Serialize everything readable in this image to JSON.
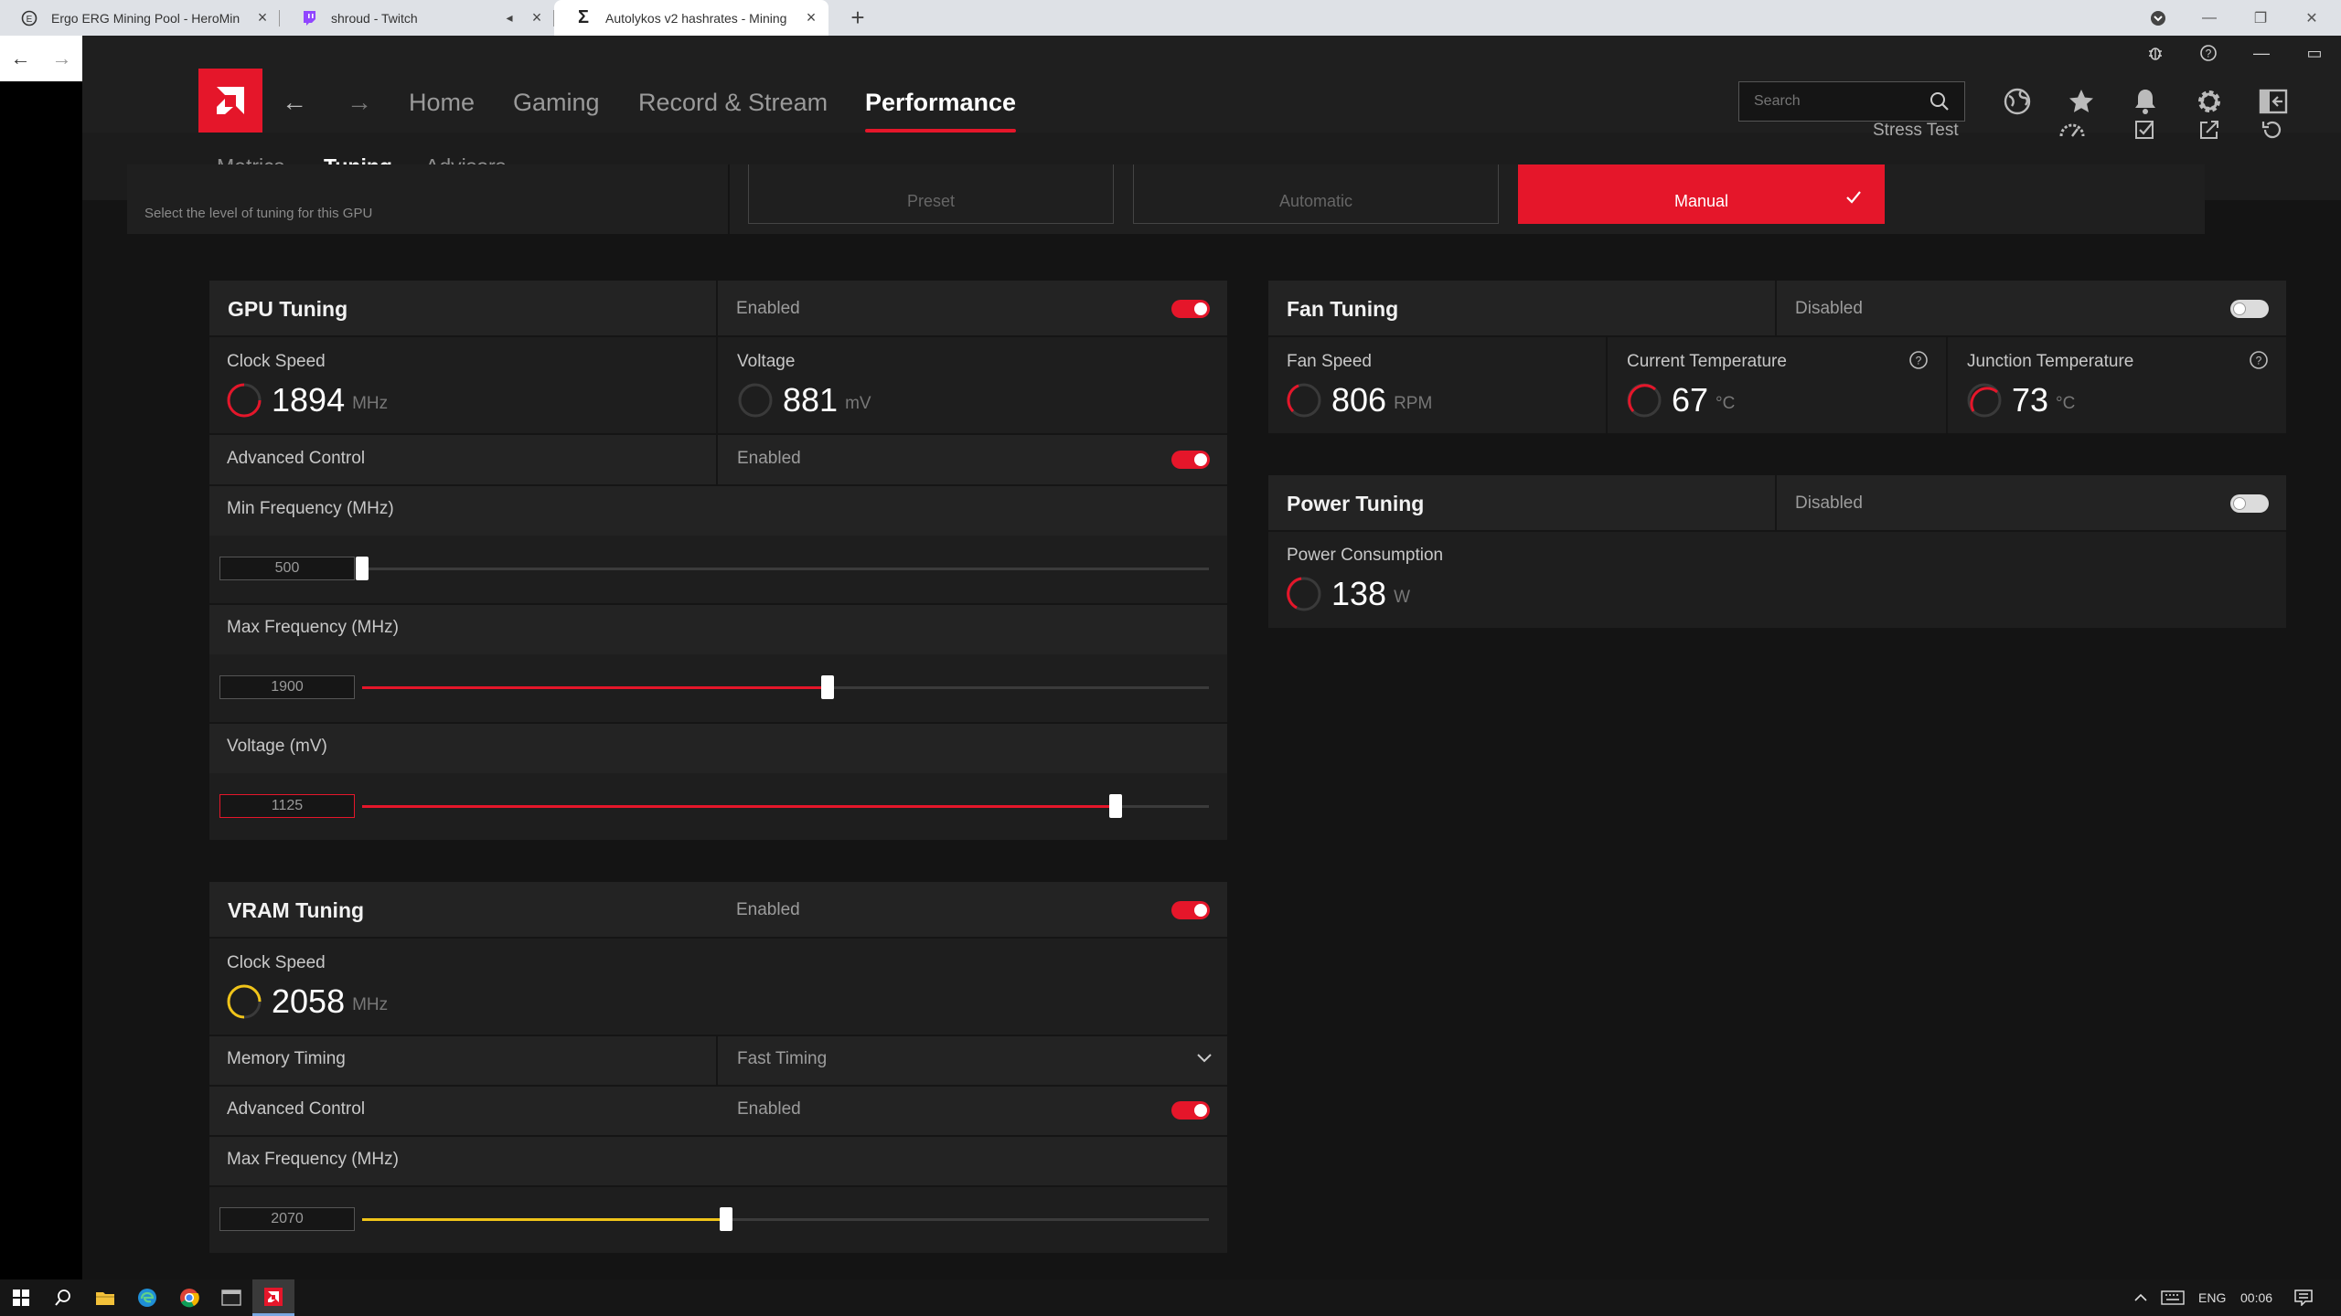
{
  "browser": {
    "tabs": [
      {
        "title": "Ergo ERG Mining Pool - HeroMin",
        "icon": "herominers-icon",
        "active": false
      },
      {
        "title": "shroud - Twitch",
        "icon": "twitch-icon",
        "active": false
      },
      {
        "title": "Autolykos v2 hashrates - Mining",
        "icon": "sigma-icon",
        "active": true
      }
    ]
  },
  "app": {
    "nav": [
      "Home",
      "Gaming",
      "Record & Stream",
      "Performance"
    ],
    "selected_nav": "Performance",
    "search_placeholder": "Search",
    "subnav": [
      "Metrics",
      "Tuning",
      "Advisors"
    ],
    "selected_subnav": "Tuning",
    "stress_test": "Stress Test"
  },
  "tuning_control": {
    "description": "Select the level of tuning for this GPU",
    "options": [
      "Preset",
      "Automatic",
      "Manual"
    ],
    "selected": "Manual"
  },
  "gpu_tuning": {
    "title": "GPU Tuning",
    "status": "Enabled",
    "clock_speed": {
      "label": "Clock Speed",
      "value": "1894",
      "unit": "MHz"
    },
    "voltage": {
      "label": "Voltage",
      "value": "881",
      "unit": "mV"
    },
    "advanced_control": {
      "label": "Advanced Control",
      "status": "Enabled"
    },
    "min_frequency": {
      "label": "Min Frequency (MHz)",
      "value": "500",
      "fraction": 0.0
    },
    "max_frequency": {
      "label": "Max Frequency (MHz)",
      "value": "1900",
      "fraction": 0.55
    },
    "voltage_slider": {
      "label": "Voltage (mV)",
      "value": "1125",
      "fraction": 0.89
    }
  },
  "vram_tuning": {
    "title": "VRAM Tuning",
    "status": "Enabled",
    "clock_speed": {
      "label": "Clock Speed",
      "value": "2058",
      "unit": "MHz"
    },
    "memory_timing": {
      "label": "Memory Timing",
      "value": "Fast Timing"
    },
    "advanced_control": {
      "label": "Advanced Control",
      "status": "Enabled"
    },
    "max_frequency": {
      "label": "Max Frequency (MHz)",
      "value": "2070",
      "fraction": 0.43
    }
  },
  "fan_tuning": {
    "title": "Fan Tuning",
    "status": "Disabled",
    "fan_speed": {
      "label": "Fan Speed",
      "value": "806",
      "unit": "RPM"
    },
    "current_temperature": {
      "label": "Current Temperature",
      "value": "67",
      "unit": "°C"
    },
    "junction_temperature": {
      "label": "Junction Temperature",
      "value": "73",
      "unit": "°C"
    }
  },
  "power_tuning": {
    "title": "Power Tuning",
    "status": "Disabled",
    "power_consumption": {
      "label": "Power Consumption",
      "value": "138",
      "unit": "W"
    }
  },
  "taskbar": {
    "language": "ENG",
    "time": "00:06"
  },
  "colors": {
    "accent_red": "#e5162a",
    "vram_yellow": "#f0c419",
    "background": "#141414"
  }
}
